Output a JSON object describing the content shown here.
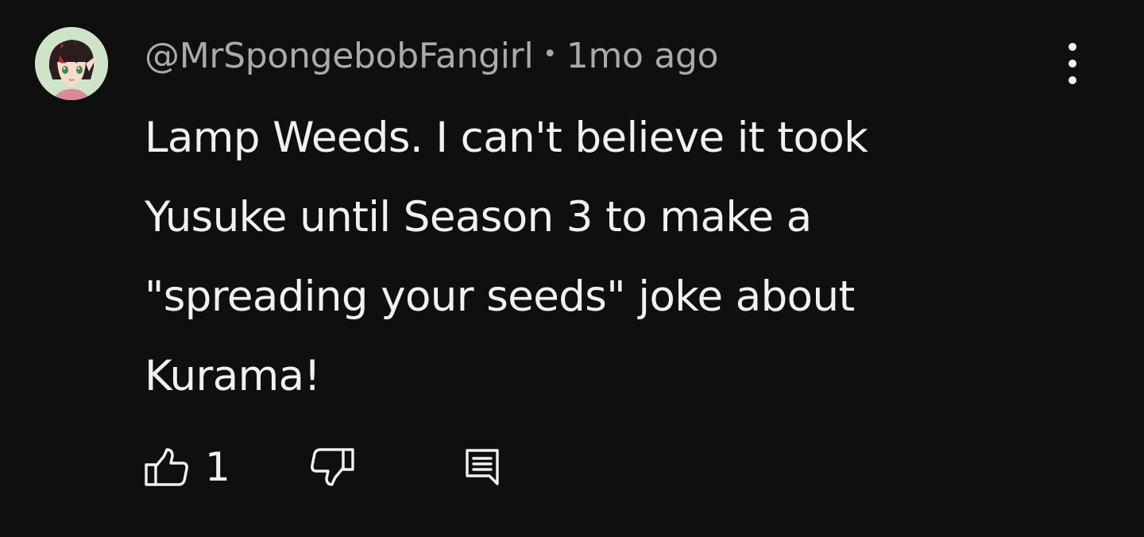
{
  "comment": {
    "author": "@MrSpongebobFangirl",
    "separator": "•",
    "timestamp": "1mo ago",
    "text": "Lamp Weeds. I can't believe it took Yusuke until Season 3 to make a \"spreading your seeds\" joke about Kurama!",
    "like_count": "1"
  },
  "icons": {
    "avatar": "avatar-anime-character",
    "more": "more-vertical-icon",
    "like": "thumbs-up-icon",
    "dislike": "thumbs-down-icon",
    "reply": "reply-comment-icon"
  },
  "colors": {
    "background": "#0f0f0f",
    "primary_text": "#f1f1f1",
    "secondary_text": "#aaaaaa"
  }
}
